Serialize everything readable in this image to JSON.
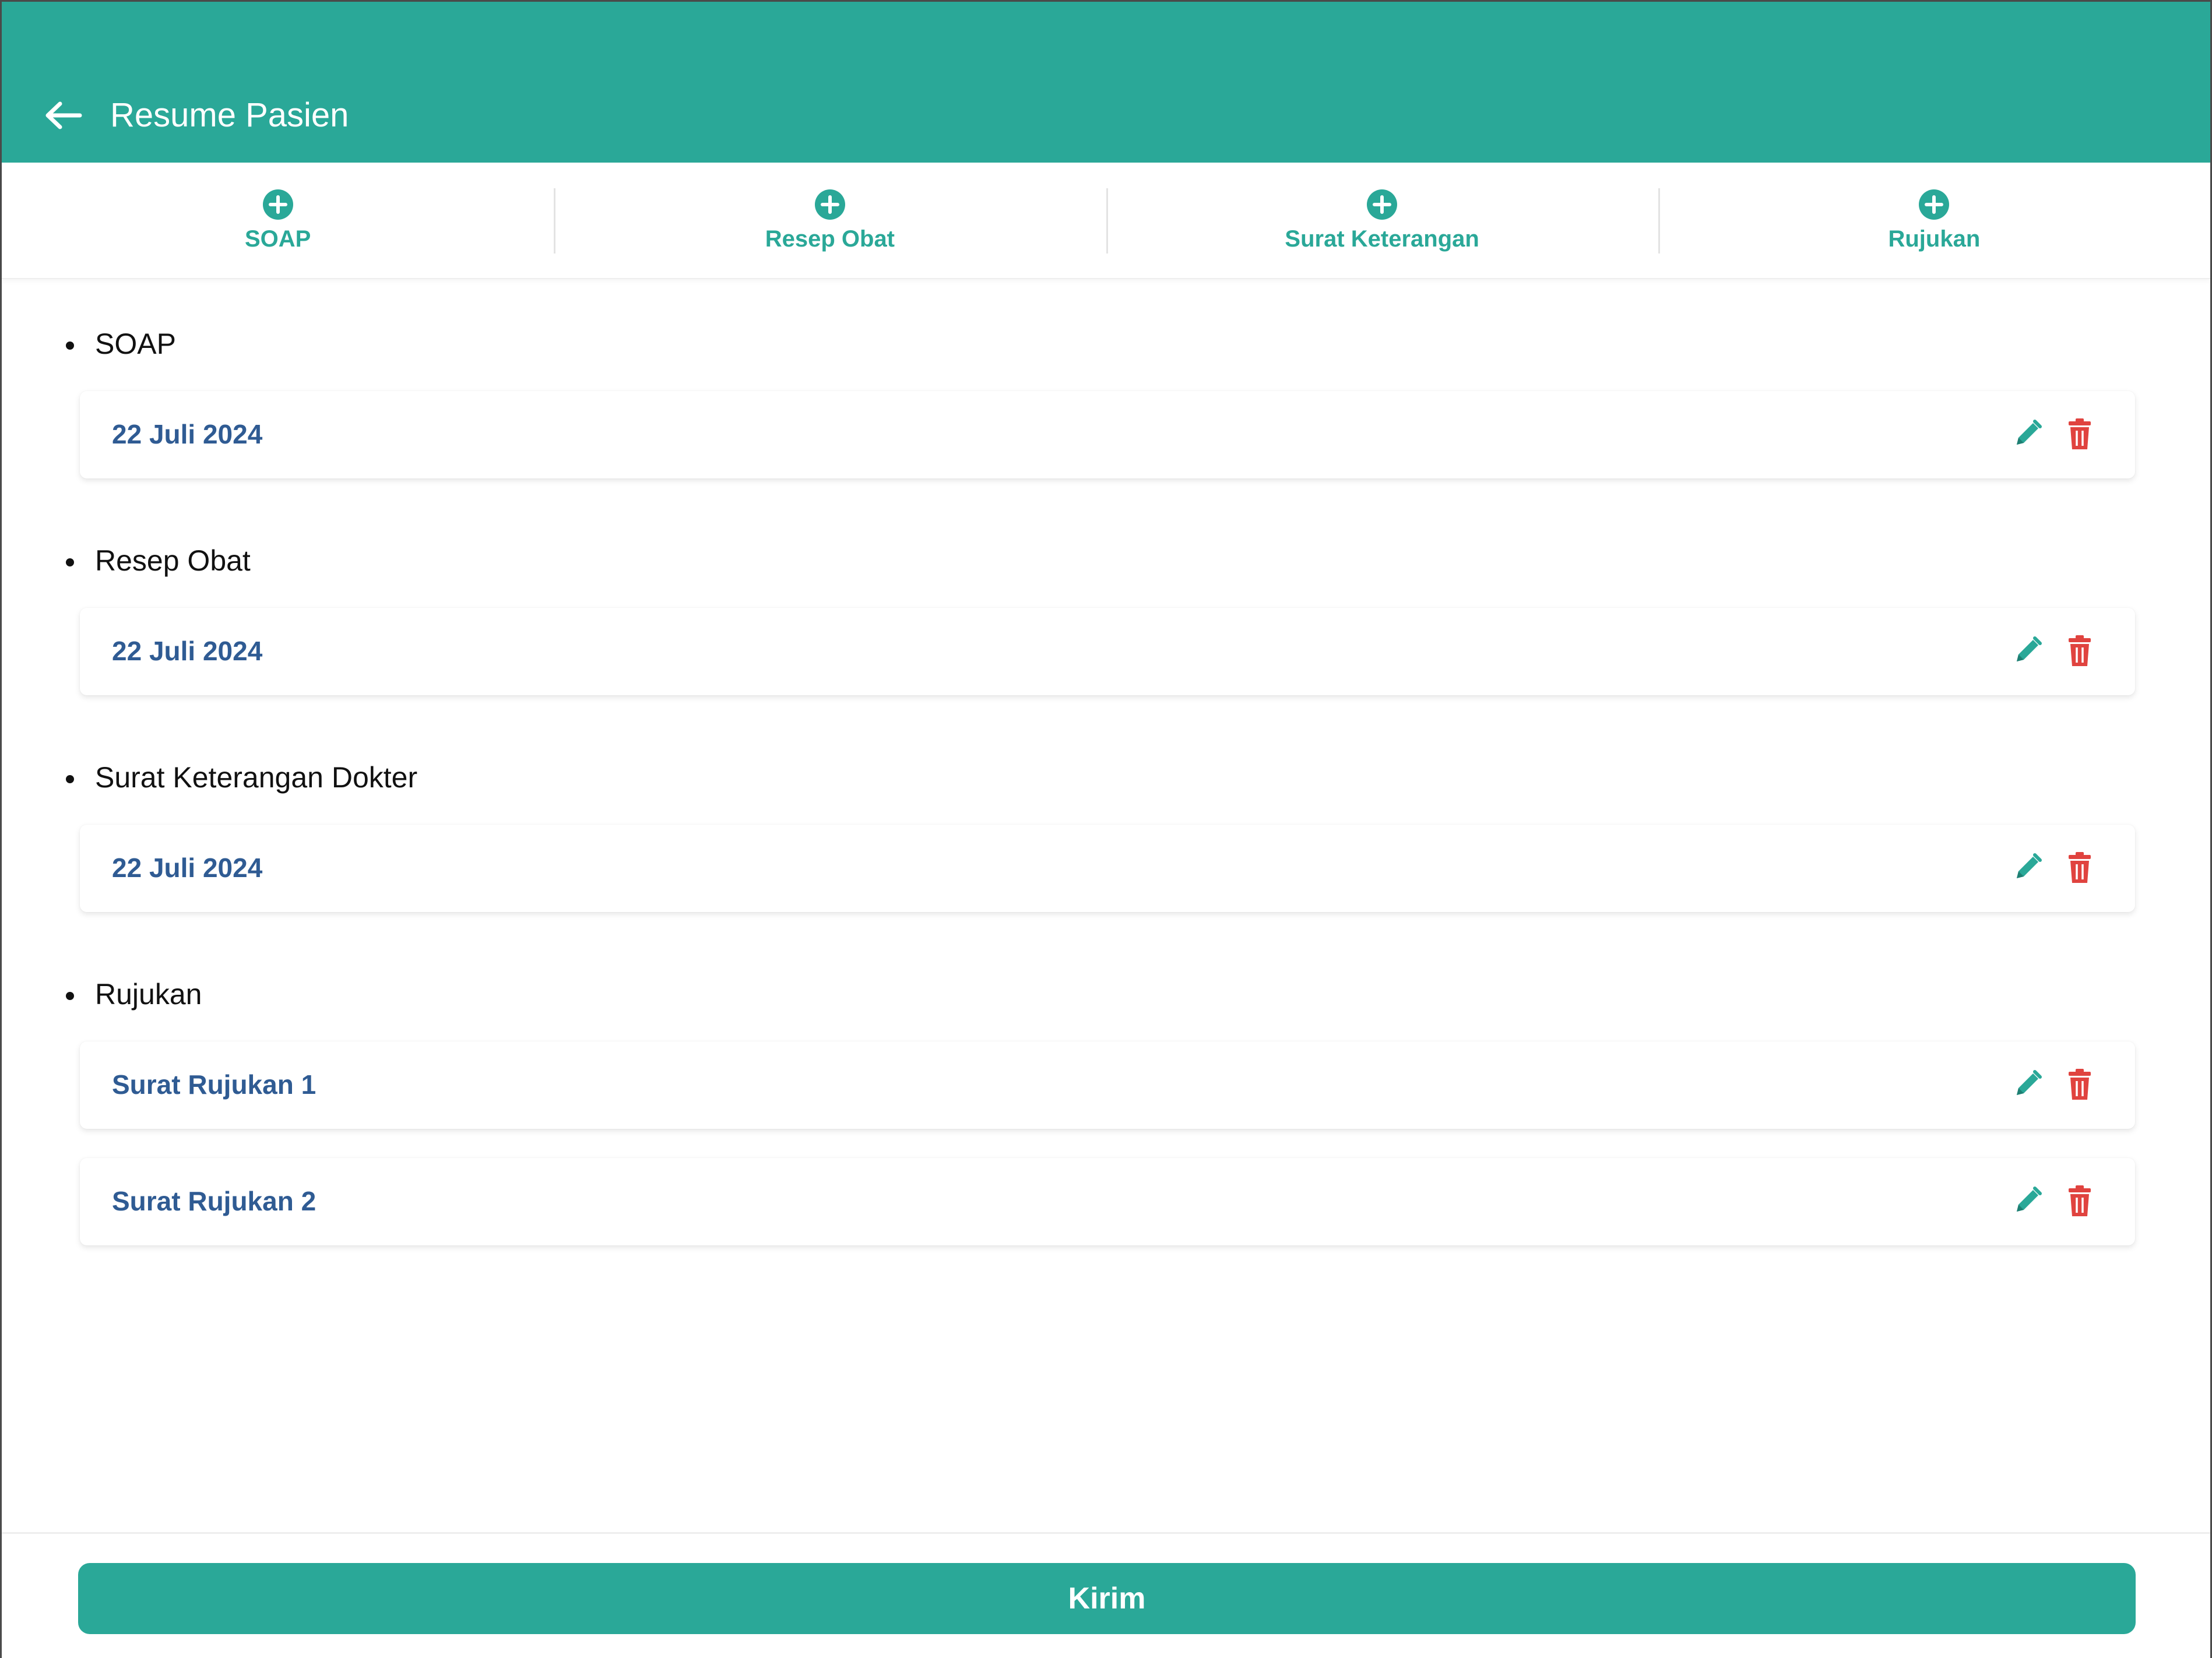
{
  "header": {
    "title": "Resume Pasien",
    "back_icon": "arrow-left-icon",
    "background_color": "#2aa898"
  },
  "tabs": [
    {
      "label": "SOAP",
      "icon": "plus-circle-icon"
    },
    {
      "label": "Resep Obat",
      "icon": "plus-circle-icon"
    },
    {
      "label": "Surat Keterangan",
      "icon": "plus-circle-icon"
    },
    {
      "label": "Rujukan",
      "icon": "plus-circle-icon"
    }
  ],
  "sections": [
    {
      "title": "SOAP",
      "items": [
        {
          "label": "22 Juli 2024"
        }
      ]
    },
    {
      "title": "Resep Obat",
      "items": [
        {
          "label": "22 Juli 2024"
        }
      ]
    },
    {
      "title": "Surat Keterangan Dokter",
      "items": [
        {
          "label": "22 Juli 2024"
        }
      ]
    },
    {
      "title": "Rujukan",
      "items": [
        {
          "label": "Surat Rujukan 1"
        },
        {
          "label": "Surat Rujukan 2"
        }
      ]
    }
  ],
  "item_actions": {
    "edit_icon": "pencil-icon",
    "delete_icon": "trash-icon"
  },
  "footer": {
    "submit_label": "Kirim"
  },
  "colors": {
    "accent": "#2aa898",
    "item_text": "#2f5b93",
    "delete": "#e0433f"
  }
}
